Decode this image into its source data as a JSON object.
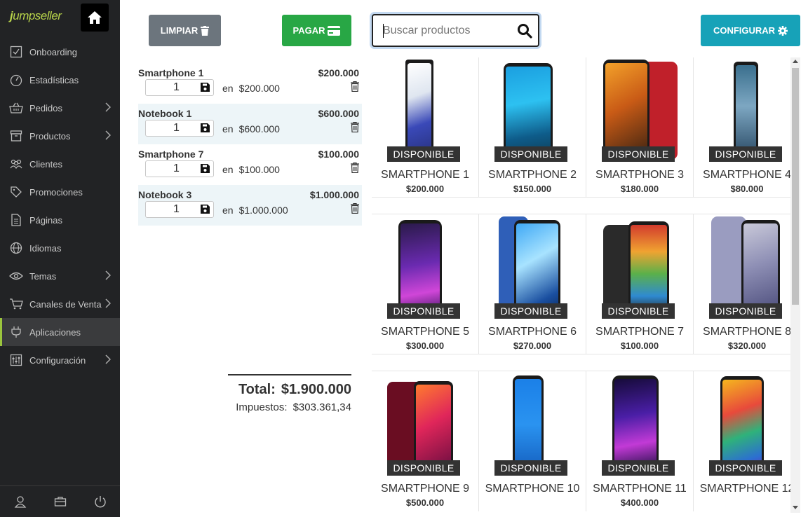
{
  "sidebar": {
    "logo_j": "j",
    "logo_rest": "umpseller",
    "items": [
      {
        "label": "Onboarding",
        "icon": "checkbox-icon",
        "chevron": false
      },
      {
        "label": "Estadísticas",
        "icon": "gauge-icon",
        "chevron": false
      },
      {
        "label": "Pedidos",
        "icon": "basket-icon",
        "chevron": true
      },
      {
        "label": "Productos",
        "icon": "box-icon",
        "chevron": true
      },
      {
        "label": "Clientes",
        "icon": "users-icon",
        "chevron": false
      },
      {
        "label": "Promociones",
        "icon": "tag-icon",
        "chevron": false
      },
      {
        "label": "Páginas",
        "icon": "page-icon",
        "chevron": false
      },
      {
        "label": "Idiomas",
        "icon": "globe-icon",
        "chevron": false
      },
      {
        "label": "Temas",
        "icon": "eye-icon",
        "chevron": true
      },
      {
        "label": "Canales de Venta",
        "icon": "cart-icon",
        "chevron": true
      },
      {
        "label": "Aplicaciones",
        "icon": "plug-icon",
        "chevron": false,
        "active": true
      },
      {
        "label": "Configuración",
        "icon": "settings-icon",
        "chevron": true
      }
    ]
  },
  "toolbar": {
    "clear_label": "LIMPIAR",
    "pay_label": "PAGAR",
    "config_label": "CONFIGURAR",
    "search_placeholder": "Buscar productos"
  },
  "cart": {
    "items": [
      {
        "name": "Smartphone 1",
        "qty": "1",
        "unit_prefix": "en",
        "unit_price": "$200.000",
        "line_total": "$200.000"
      },
      {
        "name": "Notebook 1",
        "qty": "1",
        "unit_prefix": "en",
        "unit_price": "$600.000",
        "line_total": "$600.000"
      },
      {
        "name": "Smartphone 7",
        "qty": "1",
        "unit_prefix": "en",
        "unit_price": "$100.000",
        "line_total": "$100.000"
      },
      {
        "name": "Notebook 3",
        "qty": "1",
        "unit_prefix": "en",
        "unit_price": "$1.000.000",
        "line_total": "$1.000.000"
      }
    ],
    "total_label": "Total:",
    "total_value": "$1.900.000",
    "tax_label": "Impuestos:",
    "tax_value": "$303.361,34"
  },
  "products": [
    {
      "name": "SMARTPHONE 1",
      "price": "$200.000",
      "badge": "DISPONIBLE"
    },
    {
      "name": "SMARTPHONE 2",
      "price": "$150.000",
      "badge": "DISPONIBLE"
    },
    {
      "name": "SMARTPHONE 3",
      "price": "$180.000",
      "badge": "DISPONIBLE"
    },
    {
      "name": "SMARTPHONE 4",
      "price": "$80.000",
      "badge": "DISPONIBLE"
    },
    {
      "name": "SMARTPHONE 5",
      "price": "$300.000",
      "badge": "DISPONIBLE"
    },
    {
      "name": "SMARTPHONE 6",
      "price": "$270.000",
      "badge": "DISPONIBLE"
    },
    {
      "name": "SMARTPHONE 7",
      "price": "$100.000",
      "badge": "DISPONIBLE"
    },
    {
      "name": "SMARTPHONE 8",
      "price": "$320.000",
      "badge": "DISPONIBLE"
    },
    {
      "name": "SMARTPHONE 9",
      "price": "$500.000",
      "badge": "DISPONIBLE"
    },
    {
      "name": "SMARTPHONE 10",
      "price": "",
      "badge": "DISPONIBLE"
    },
    {
      "name": "SMARTPHONE 11",
      "price": "$400.000",
      "badge": "DISPONIBLE"
    },
    {
      "name": "SMARTPHONE 12",
      "price": "",
      "badge": "DISPONIBLE"
    }
  ],
  "colors": {
    "sidebar_bg": "#222325",
    "accent_green": "#9bc53d",
    "clear_btn": "#6c757d",
    "pay_btn": "#28a745",
    "config_btn": "#17a2b8",
    "badge_bg": "#333333"
  }
}
